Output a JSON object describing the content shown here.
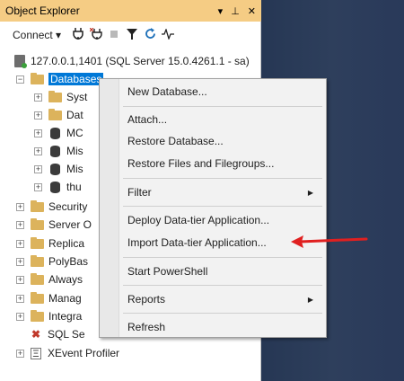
{
  "panel": {
    "title": "Object Explorer",
    "controls": [
      "▾",
      "⊥",
      "✕"
    ]
  },
  "toolbar": {
    "connect_label": "Connect ▾",
    "icons": [
      "connect-icon",
      "disconnect-icon",
      "stop-icon",
      "filter-icon",
      "refresh-icon",
      "activity-icon"
    ]
  },
  "tree": {
    "server": "127.0.0.1,1401 (SQL Server 15.0.4261.1 - sa)",
    "databases": "Databases",
    "children": [
      "Syst",
      "Dat",
      "MC",
      "Mis",
      "Mis",
      "thu"
    ],
    "top_items": [
      "Security",
      "Server O",
      "Replica",
      "PolyBas",
      "Always",
      "Manag",
      "Integra",
      "SQL Se",
      "XEvent Profiler"
    ]
  },
  "context_menu": {
    "items": [
      "New Database...",
      "Attach...",
      "Restore Database...",
      "Restore Files and Filegroups...",
      "Filter",
      "Deploy Data-tier Application...",
      "Import Data-tier Application...",
      "Start PowerShell",
      "Reports",
      "Refresh"
    ]
  },
  "colors": {
    "title_bar": "#f5cc84",
    "selection": "#0078d7",
    "annotation_arrow": "#e02020",
    "background": "#2b3c58"
  }
}
